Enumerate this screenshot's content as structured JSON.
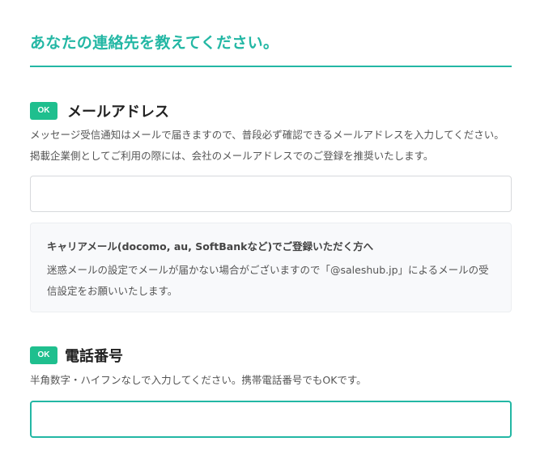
{
  "section": {
    "title": "あなたの連絡先を教えてください。"
  },
  "email_field": {
    "badge": "OK",
    "label": "メールアドレス",
    "help": "メッセージ受信通知はメールで届きますので、普段必ず確認できるメールアドレスを入力してください。掲載企業側としてご利用の際には、会社のメールアドレスでのご登録を推奨いたします。",
    "value": "",
    "placeholder": ""
  },
  "carrier_notice": {
    "title": "キャリアメール(docomo, au, SoftBankなど)でご登録いただく方へ",
    "body": "迷惑メールの設定でメールが届かない場合がございますので「@saleshub.jp」によるメールの受信設定をお願いいたします。"
  },
  "phone_field": {
    "badge": "OK",
    "label": "電話番号",
    "help": "半角数字・ハイフンなしで入力してください。携帯電話番号でもOKです。",
    "value": "",
    "placeholder": ""
  },
  "colors": {
    "accent": "#23b7a4",
    "ok_badge": "#1fbf8e",
    "notice_bg": "#f8f9fb"
  }
}
